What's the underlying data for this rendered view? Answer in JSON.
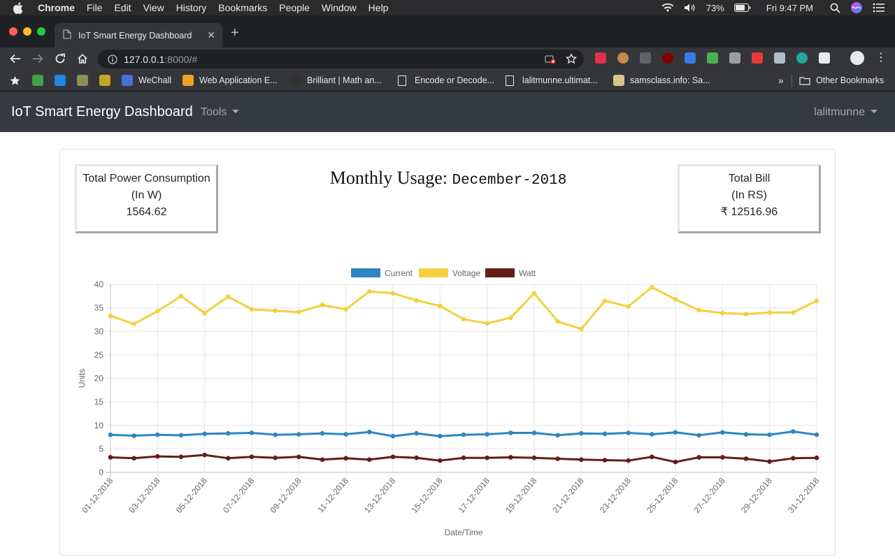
{
  "menubar": {
    "app": "Chrome",
    "items": [
      "File",
      "Edit",
      "View",
      "History",
      "Bookmarks",
      "People",
      "Window",
      "Help"
    ],
    "battery": "73%",
    "clock": "Fri 9:47 PM"
  },
  "browser": {
    "tab_title": "IoT Smart Energy Dashboard",
    "url_host": "127.0.0.1",
    "url_path": ":8000/#",
    "bookmarks": [
      {
        "label": "WeChall",
        "color": "#4a6fd6"
      },
      {
        "label": "Web Application E...",
        "color": "#f0a020"
      },
      {
        "label": "Brilliant | Math an...",
        "color": "#333333"
      },
      {
        "label": "Encode or Decode...",
        "color": "#e8eaed"
      },
      {
        "label": "lalitmunne.ultimat...",
        "color": "#e8eaed"
      },
      {
        "label": "samsclass.info: Sa...",
        "color": "#d9c48a"
      }
    ],
    "other_bookmarks": "Other Bookmarks",
    "overflow": "»"
  },
  "app": {
    "brand": "IoT Smart Energy Dashboard",
    "tools_menu": "Tools",
    "user_menu": "lalitmunne"
  },
  "power": {
    "label_line1": "Total Power Consumption",
    "label_line2": "(In W)",
    "value": "1564.62"
  },
  "bill": {
    "label_line1": "Total Bill",
    "label_line2": "(In RS)",
    "value": "₹ 12516.96"
  },
  "heading": {
    "prefix": "Monthly Usage:",
    "month": "December-2018"
  },
  "chart_data": {
    "type": "line",
    "xlabel": "Date/Time",
    "ylabel": "Units",
    "ylim": [
      0,
      40
    ],
    "yticks": [
      0,
      5,
      10,
      15,
      20,
      25,
      30,
      35,
      40
    ],
    "grid": true,
    "legend_position": "top",
    "x": [
      "01-12-2018",
      "02-12-2018",
      "03-12-2018",
      "04-12-2018",
      "05-12-2018",
      "06-12-2018",
      "07-12-2018",
      "08-12-2018",
      "09-12-2018",
      "10-12-2018",
      "11-12-2018",
      "12-12-2018",
      "13-12-2018",
      "14-12-2018",
      "15-12-2018",
      "16-12-2018",
      "17-12-2018",
      "18-12-2018",
      "19-12-2018",
      "20-12-2018",
      "21-12-2018",
      "22-12-2018",
      "23-12-2018",
      "24-12-2018",
      "25-12-2018",
      "26-12-2018",
      "27-12-2018",
      "28-12-2018",
      "29-12-2018",
      "30-12-2018",
      "31-12-2018"
    ],
    "x_tick_labels": [
      "01-12-2018",
      "03-12-2018",
      "05-12-2018",
      "07-12-2018",
      "09-12-2018",
      "11-12-2018",
      "13-12-2018",
      "15-12-2018",
      "17-12-2018",
      "19-12-2018",
      "21-12-2018",
      "23-12-2018",
      "25-12-2018",
      "27-12-2018",
      "29-12-2018",
      "31-12-2018"
    ],
    "series": [
      {
        "name": "Current",
        "color": "#2e86c1",
        "values": [
          8.0,
          7.8,
          8.0,
          7.9,
          8.2,
          8.3,
          8.4,
          8.0,
          8.1,
          8.3,
          8.1,
          8.6,
          7.7,
          8.3,
          7.7,
          8.0,
          8.1,
          8.4,
          8.4,
          7.9,
          8.3,
          8.2,
          8.4,
          8.1,
          8.5,
          7.9,
          8.5,
          8.1,
          8.0,
          8.7,
          8.0
        ]
      },
      {
        "name": "Voltage",
        "color": "#f4d03f",
        "values": [
          33.3,
          31.6,
          34.3,
          37.5,
          33.9,
          37.4,
          34.7,
          34.4,
          34.1,
          35.6,
          34.7,
          38.5,
          38.1,
          36.6,
          35.4,
          32.6,
          31.7,
          32.9,
          38.1,
          32.1,
          30.5,
          36.5,
          35.3,
          39.4,
          36.8,
          34.5,
          33.9,
          33.7,
          34.0,
          34.0,
          36.5
        ]
      },
      {
        "name": "Watt",
        "color": "#641e16",
        "values": [
          3.2,
          3.0,
          3.4,
          3.3,
          3.7,
          3.0,
          3.3,
          3.1,
          3.3,
          2.7,
          3.0,
          2.7,
          3.3,
          3.1,
          2.5,
          3.1,
          3.1,
          3.2,
          3.1,
          2.9,
          2.7,
          2.6,
          2.5,
          3.3,
          2.2,
          3.2,
          3.2,
          2.9,
          2.3,
          3.0,
          3.1
        ]
      }
    ]
  }
}
